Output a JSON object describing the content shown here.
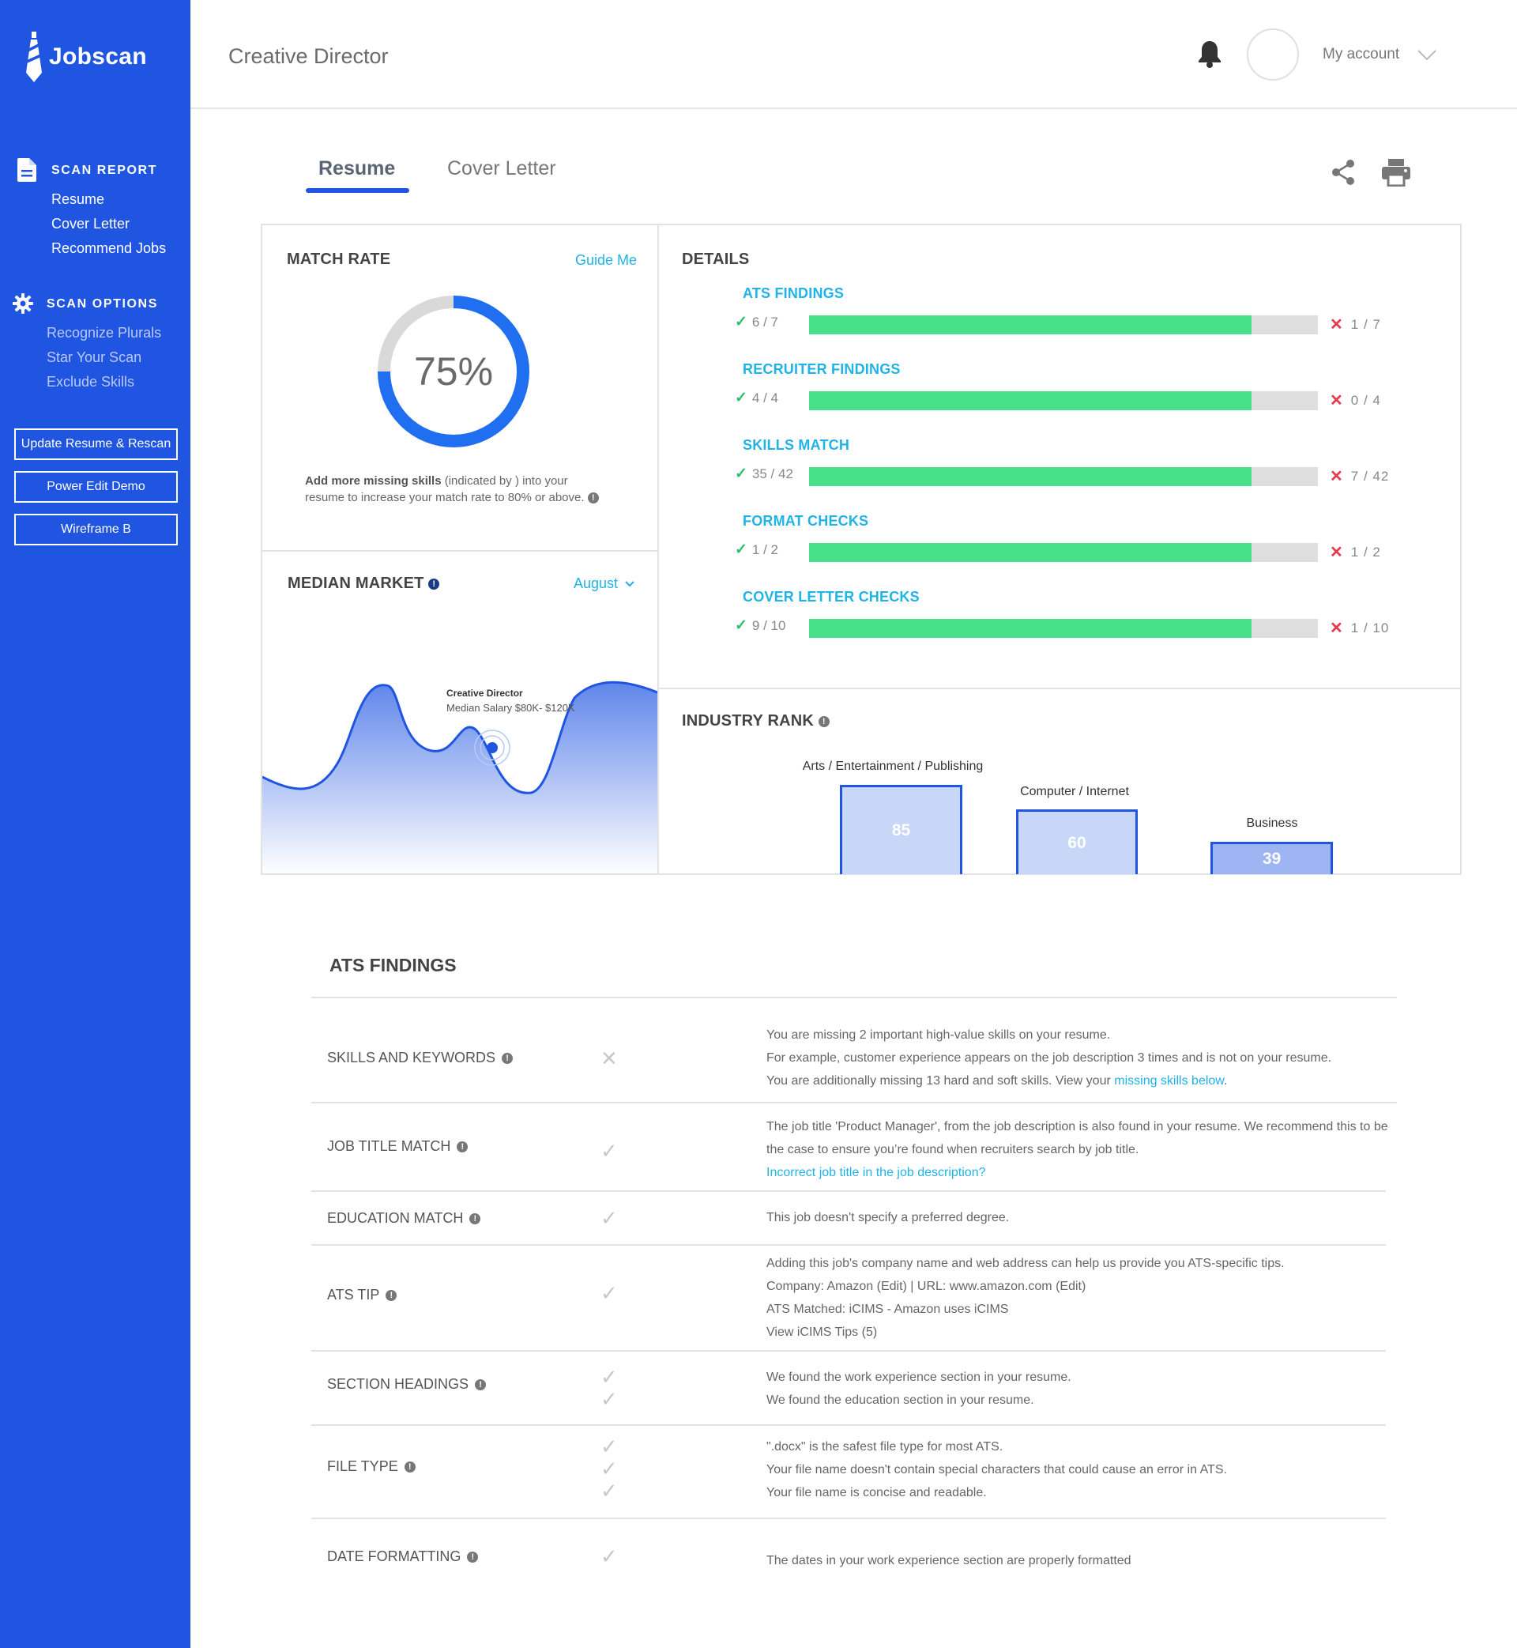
{
  "brand": {
    "name": "Jobscan"
  },
  "sidebar": {
    "scan_report": {
      "title": "SCAN REPORT",
      "items": [
        "Resume",
        "Cover Letter",
        "Recommend Jobs"
      ]
    },
    "scan_options": {
      "title": "SCAN OPTIONS",
      "items": [
        "Recognize Plurals",
        "Star Your Scan",
        "Exclude Skills"
      ]
    },
    "buttons": [
      "Update Resume & Rescan",
      "Power Edit Demo",
      "Wireframe B"
    ]
  },
  "header": {
    "title": "Creative Director",
    "account_label": "My account"
  },
  "tabs": [
    {
      "label": "Resume",
      "active": true
    },
    {
      "label": "Cover Letter",
      "active": false
    }
  ],
  "match_rate": {
    "title": "MATCH RATE",
    "guide_label": "Guide Me",
    "value": 75,
    "value_label": "75%",
    "note_bold": "Add more missing skills",
    "note_rest_1": " (indicated by  ) into your",
    "note_line2": "resume to increase your match rate to 80% or above."
  },
  "median_market": {
    "title": "MEDIAN MARKET",
    "month": "August",
    "tooltip_title": "Creative Director",
    "tooltip_sub": "Median Salary $80K- $120K"
  },
  "details": {
    "title": "DETAILS",
    "rows": [
      {
        "label": "ATS FINDINGS",
        "ok": "6 / 7",
        "bad": "1 / 7",
        "fill": 0.87
      },
      {
        "label": "RECRUITER FINDINGS",
        "ok": "4 / 4",
        "bad": "0 / 4",
        "fill": 0.87
      },
      {
        "label": "SKILLS MATCH",
        "ok": "35 / 42",
        "bad": "7 / 42",
        "fill": 0.87
      },
      {
        "label": "FORMAT CHECKS",
        "ok": "1 / 2",
        "bad": "1 / 2",
        "fill": 0.87
      },
      {
        "label": "COVER LETTER CHECKS",
        "ok": "9 / 10",
        "bad": "1 / 10",
        "fill": 0.87
      }
    ]
  },
  "industry_rank": {
    "title": "INDUSTRY RANK",
    "items": [
      {
        "category": "Arts / Entertainment / Publishing",
        "value": "85"
      },
      {
        "category": "Computer / Internet",
        "value": "60"
      },
      {
        "category": "Business",
        "value": "39"
      }
    ]
  },
  "ats_findings": {
    "title": "ATS FINDINGS",
    "rows": [
      {
        "label": "SKILLS AND KEYWORDS",
        "lines": [
          "You are missing 2 important high-value skills on your resume.",
          "For example, customer experience appears on the job description 3 times and is not on your resume.",
          "You are additionally missing 13 hard and soft skills. View your "
        ],
        "link": "missing skills below",
        "after_link": "."
      },
      {
        "label": "JOB TITLE MATCH",
        "lines": [
          "The job title 'Product Manager', from the job description is also found in your resume. We recommend this to be",
          "the case to ensure you’re found when recruiters search by job title."
        ],
        "link": "Incorrect job title in the job description?"
      },
      {
        "label": "EDUCATION MATCH",
        "lines": [
          "This job doesn't specify a preferred degree."
        ]
      },
      {
        "label": "ATS TIP",
        "lines": [
          "Adding this job's company name and web address can help us provide you ATS-specific tips.",
          "Company: Amazon (Edit) | URL: www.amazon.com (Edit)",
          "ATS Matched: iCIMS - Amazon uses iCIMS",
          "View iCIMS Tips (5)"
        ]
      },
      {
        "label": "SECTION HEADINGS",
        "lines": [
          "We found the work experience section in your resume.",
          "We found the education section in your resume."
        ]
      },
      {
        "label": "FILE TYPE",
        "lines": [
          "\".docx\" is the safest file type for most ATS.",
          "Your file name doesn't contain special characters that could cause an error in ATS.",
          "Your file name is concise and readable."
        ]
      },
      {
        "label": "DATE FORMATTING",
        "lines": [
          "The dates in your work experience section are properly formatted"
        ]
      }
    ]
  },
  "colors": {
    "brand_blue": "#1f55e0",
    "accent_cyan": "#1fb3e8",
    "bar_green": "#45e088",
    "error_red": "#e8364a"
  }
}
